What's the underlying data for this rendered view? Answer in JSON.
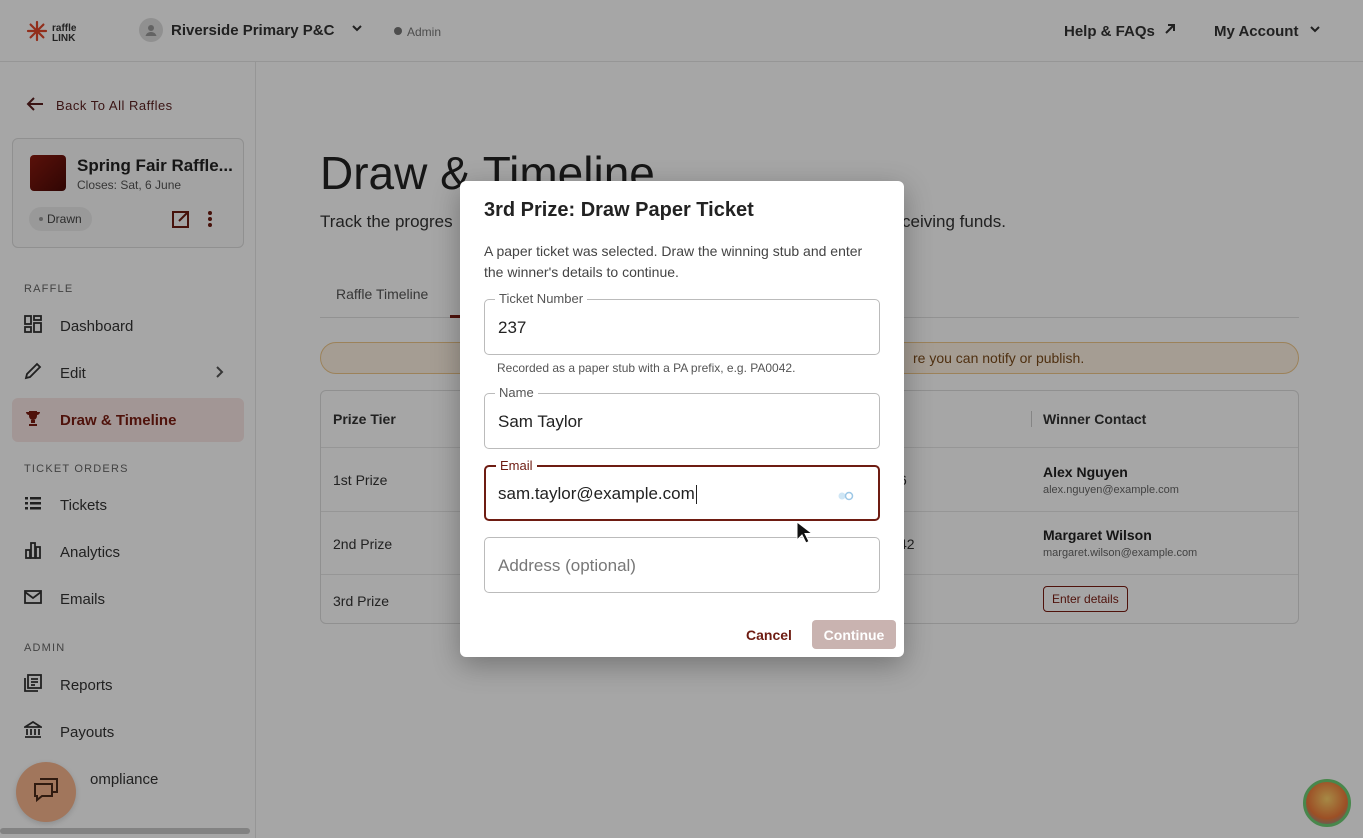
{
  "header": {
    "logo_line1": "raffle",
    "logo_line2": "LINK",
    "org_name": "Riverside Primary P&C",
    "role": "Admin",
    "help_label": "Help & FAQs",
    "account_label": "My Account"
  },
  "sidebar": {
    "back_label": "Back To All Raffles",
    "raffle_name": "Spring Fair Raffle...",
    "raffle_close": "Closes: Sat, 6 June",
    "status_badge": "Drawn",
    "sections": {
      "raffle": "RAFFLE",
      "ticket_orders": "TICKET ORDERS",
      "admin": "ADMIN"
    },
    "items": [
      {
        "label": "Dashboard",
        "icon": "dashboard-icon"
      },
      {
        "label": "Edit",
        "icon": "pencil-icon"
      },
      {
        "label": "Draw & Timeline",
        "icon": "trophy-icon"
      },
      {
        "label": "Tickets",
        "icon": "list-icon"
      },
      {
        "label": "Analytics",
        "icon": "bar-chart-icon"
      },
      {
        "label": "Emails",
        "icon": "mail-icon"
      },
      {
        "label": "Reports",
        "icon": "reports-icon"
      },
      {
        "label": "Payouts",
        "icon": "bank-icon"
      },
      {
        "label": "ompliance",
        "icon": "compliance-icon"
      }
    ]
  },
  "main": {
    "title": "Draw & Timeline",
    "subtitle_left": "Track the progres",
    "subtitle_right": "ceiving funds.",
    "tab_label": "Raffle Timeline",
    "alert_text": "re you can notify or publish.",
    "table": {
      "headers": {
        "tier": "Prize Tier",
        "ticket": "t",
        "contact": "Winner Contact"
      },
      "rows": [
        {
          "tier": "1st Prize",
          "ticket": "6",
          "name": "Alex Nguyen",
          "email": "alex.nguyen@example.com"
        },
        {
          "tier": "2nd Prize",
          "ticket": "42",
          "name": "Margaret Wilson",
          "email": "margaret.wilson@example.com"
        },
        {
          "tier": "3rd Prize",
          "action": "Enter details"
        }
      ]
    }
  },
  "modal": {
    "title": "3rd Prize: Draw Paper Ticket",
    "description": "A paper ticket was selected. Draw the winning stub and enter the winner's details to continue.",
    "ticket_label": "Ticket Number",
    "ticket_value": "237",
    "ticket_helper": "Recorded as a paper stub with a PA prefix, e.g. PA0042.",
    "name_label": "Name",
    "name_value": "Sam Taylor",
    "email_label": "Email",
    "email_value": "sam.taylor@example.com",
    "address_placeholder": "Address (optional)",
    "cancel_label": "Cancel",
    "continue_label": "Continue"
  },
  "colors": {
    "brand": "#7a1c12",
    "active_bg": "#f9e7e5",
    "alert_bg": "#fdf1e2",
    "continue_disabled": "#c9b3b0"
  }
}
